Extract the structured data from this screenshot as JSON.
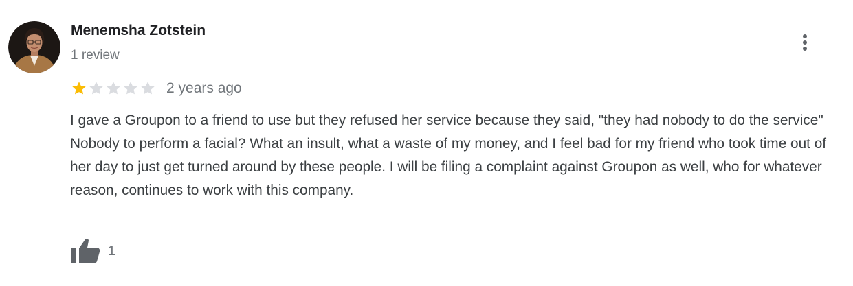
{
  "review": {
    "author_name": "Menemsha Zotstein",
    "author_meta": "1 review",
    "rating": 1,
    "rating_max": 5,
    "date": "2 years ago",
    "text": "I gave a Groupon to a friend to use but they refused her service because they said, \"they had nobody to do the service\" Nobody to perform a facial? What an insult, what a waste of my money, and I feel bad for my friend who took time out of her day to just get turned around by these people. I will be filing a complaint against Groupon as well, who for whatever reason, continues to work with this company.",
    "like_count": "1"
  },
  "icons": {
    "menu": "more-vertical-icon",
    "like": "thumb-up-icon",
    "star": "star-icon"
  },
  "colors": {
    "star_filled": "#fbbc04",
    "star_empty": "#dadce0",
    "text_primary": "#202124",
    "text_secondary": "#70757a",
    "icon": "#5f6368"
  }
}
